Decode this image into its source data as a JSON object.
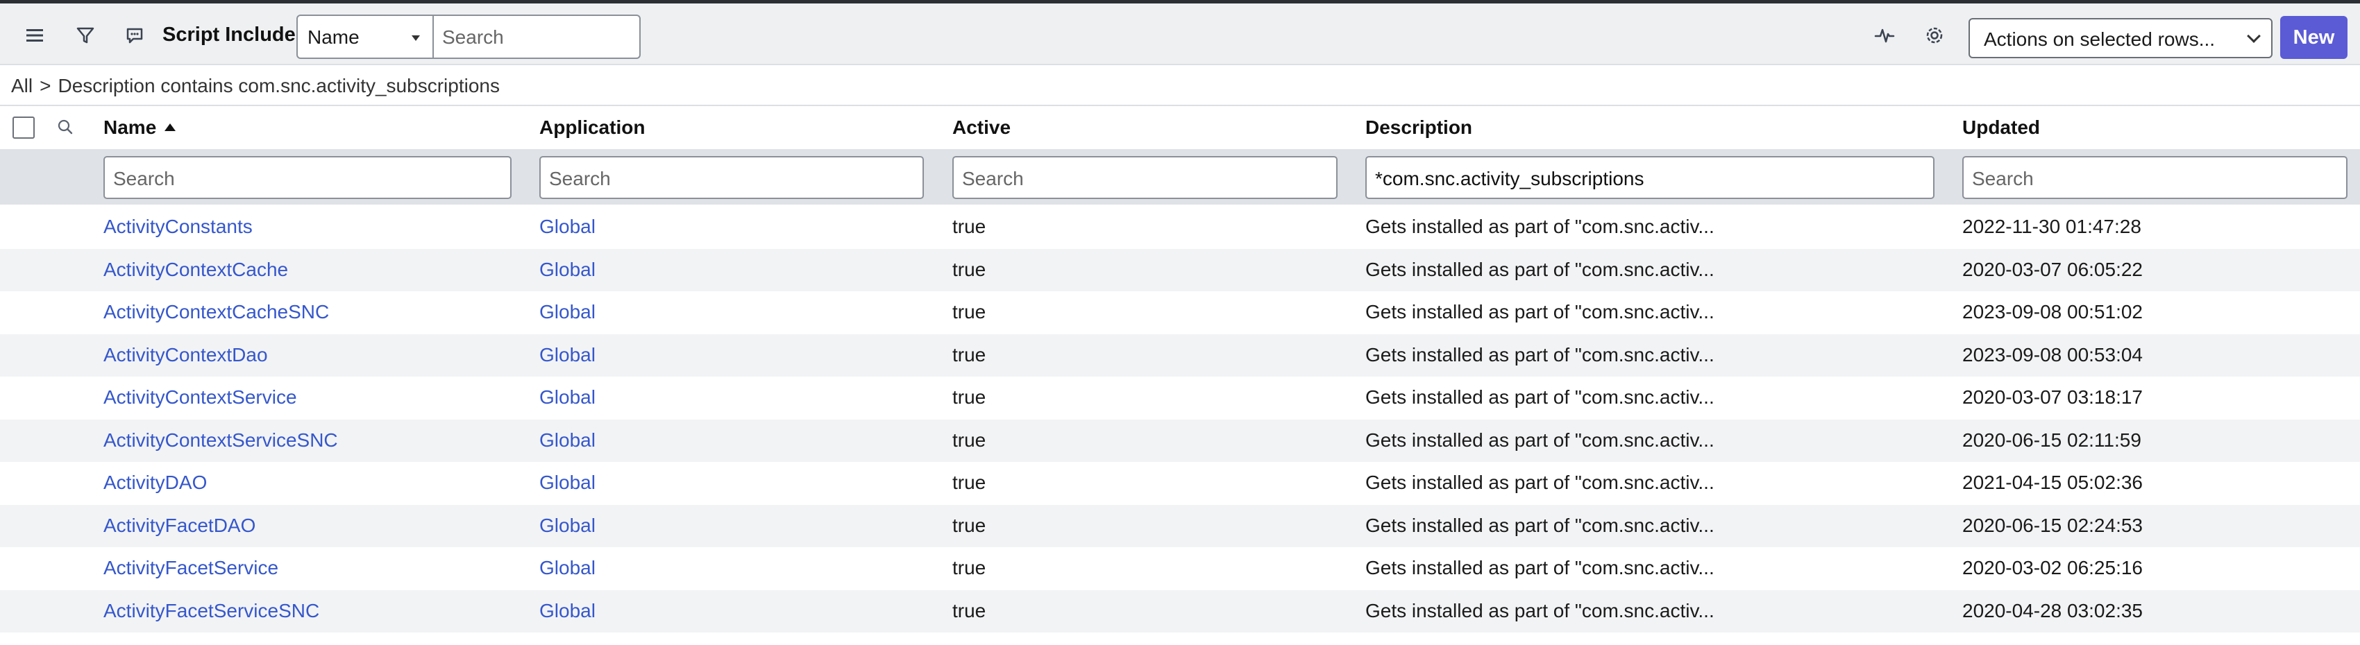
{
  "header": {
    "title": "Script Includes",
    "field_select": "Name",
    "search_placeholder": "Search",
    "actions_select": "Actions on selected rows...",
    "new_label": "New"
  },
  "breadcrumb": {
    "root": "All",
    "separator": ">",
    "filter": "Description contains com.snc.activity_subscriptions"
  },
  "columns": [
    {
      "label": "Name",
      "sorted": "asc",
      "search": "Search",
      "filled": false
    },
    {
      "label": "Application",
      "search": "Search",
      "filled": false
    },
    {
      "label": "Active",
      "search": "Search",
      "filled": false
    },
    {
      "label": "Description",
      "search": "*com.snc.activity_subscriptions",
      "filled": true
    },
    {
      "label": "Updated",
      "search": "Search",
      "filled": false
    }
  ],
  "rows": [
    {
      "name": "ActivityConstants",
      "application": "Global",
      "active": "true",
      "description": "Gets installed as part of \"com.snc.activ...",
      "updated": "2022-11-30 01:47:28"
    },
    {
      "name": "ActivityContextCache",
      "application": "Global",
      "active": "true",
      "description": "Gets installed as part of \"com.snc.activ...",
      "updated": "2020-03-07 06:05:22"
    },
    {
      "name": "ActivityContextCacheSNC",
      "application": "Global",
      "active": "true",
      "description": "Gets installed as part of \"com.snc.activ...",
      "updated": "2023-09-08 00:51:02"
    },
    {
      "name": "ActivityContextDao",
      "application": "Global",
      "active": "true",
      "description": "Gets installed as part of \"com.snc.activ...",
      "updated": "2023-09-08 00:53:04"
    },
    {
      "name": "ActivityContextService",
      "application": "Global",
      "active": "true",
      "description": "Gets installed as part of \"com.snc.activ...",
      "updated": "2020-03-07 03:18:17"
    },
    {
      "name": "ActivityContextServiceSNC",
      "application": "Global",
      "active": "true",
      "description": "Gets installed as part of \"com.snc.activ...",
      "updated": "2020-06-15 02:11:59"
    },
    {
      "name": "ActivityDAO",
      "application": "Global",
      "active": "true",
      "description": "Gets installed as part of \"com.snc.activ...",
      "updated": "2021-04-15 05:02:36"
    },
    {
      "name": "ActivityFacetDAO",
      "application": "Global",
      "active": "true",
      "description": "Gets installed as part of \"com.snc.activ...",
      "updated": "2020-06-15 02:24:53"
    },
    {
      "name": "ActivityFacetService",
      "application": "Global",
      "active": "true",
      "description": "Gets installed as part of \"com.snc.activ...",
      "updated": "2020-03-02 06:25:16"
    },
    {
      "name": "ActivityFacetServiceSNC",
      "application": "Global",
      "active": "true",
      "description": "Gets installed as part of \"com.snc.activ...",
      "updated": "2020-04-28 03:02:35"
    }
  ],
  "icons": {
    "menu": "hamburger-menu-icon",
    "filter": "funnel-filter-icon",
    "chat": "chat-bubble-icon",
    "activity": "activity-pulse-icon",
    "settings": "gear-icon",
    "column_search": "magnifier-search-icon"
  },
  "colors": {
    "link": "#3557cc",
    "primary_button": "#5b5bd6",
    "toolbar_bg": "#eef0f2",
    "search_row_bg": "#dfe2e6",
    "alt_row_bg": "#f2f3f5"
  }
}
